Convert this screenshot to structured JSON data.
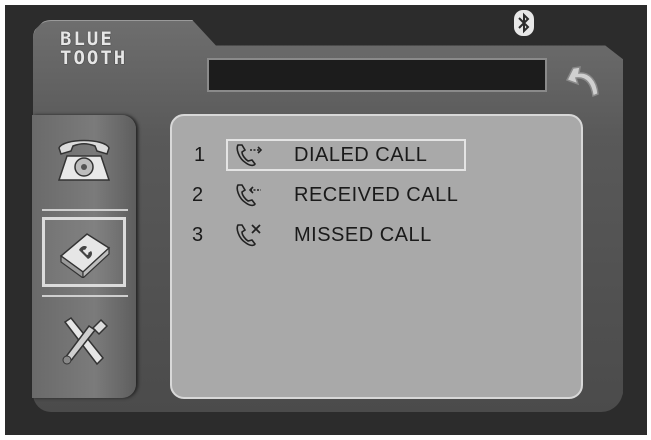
{
  "header": {
    "title_line1": "BLUE",
    "title_line2": "TOOTH"
  },
  "status": {
    "bluetooth_icon": "bluetooth-icon"
  },
  "side_menu": [
    {
      "icon": "telephone-icon",
      "selected": false
    },
    {
      "icon": "phonebook-icon",
      "selected": true
    },
    {
      "icon": "tools-icon",
      "selected": false
    }
  ],
  "call_log": {
    "items": [
      {
        "number": "1",
        "label": "DIALED CALL",
        "icon": "dialed-call-icon"
      },
      {
        "number": "2",
        "label": "RECEIVED CALL",
        "icon": "received-call-icon"
      },
      {
        "number": "3",
        "label": "MISSED CALL",
        "icon": "missed-call-icon"
      }
    ],
    "selected_index": 0
  },
  "colors": {
    "frame": "#2c2c2c",
    "panel": "#595959",
    "content": "#a9a9a9",
    "highlight": "#e4e4e4"
  }
}
